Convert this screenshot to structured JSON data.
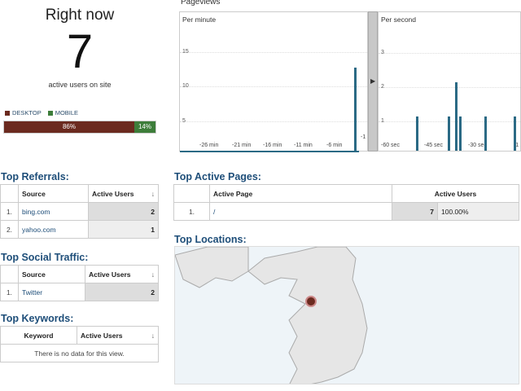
{
  "right_now": {
    "title": "Right now",
    "count": "7",
    "subtitle": "active users on site",
    "legend": [
      {
        "label": "DESKTOP",
        "color": "#6b2a1f"
      },
      {
        "label": "MOBILE",
        "color": "#3d7d3a"
      }
    ],
    "desktop_pct_label": "86%",
    "mobile_pct_label": "14%",
    "desktop_share": 86,
    "mobile_share": 14
  },
  "pageviews": {
    "title": "Pageviews",
    "per_minute": {
      "label": "Per minute",
      "y_ticks": [
        "15",
        "10",
        "5"
      ],
      "x_ticks": [
        "-26 min",
        "-21 min",
        "-16 min",
        "-11 min",
        "-6 min",
        "-1"
      ],
      "bars": [
        {
          "x": "-1",
          "value": 12
        }
      ]
    },
    "per_second": {
      "label": "Per second",
      "y_ticks": [
        "3",
        "2",
        "1"
      ],
      "x_ticks": [
        "-60 sec",
        "-45 sec",
        "-30 sec",
        "-1"
      ],
      "bars": [
        {
          "x": -45,
          "value": 1
        },
        {
          "x": -31,
          "value": 1
        },
        {
          "x": -28,
          "value": 2
        },
        {
          "x": -26,
          "value": 1
        },
        {
          "x": -15,
          "value": 1
        },
        {
          "x": -2,
          "value": 1
        }
      ]
    },
    "divider_icon": "chevron-right-icon"
  },
  "top_referrals": {
    "title": "Top Referrals:",
    "columns": [
      "Source",
      "Active Users"
    ],
    "rows": [
      {
        "n": "1.",
        "source": "bing.com",
        "users": "2"
      },
      {
        "n": "2.",
        "source": "yahoo.com",
        "users": "1"
      }
    ]
  },
  "top_social": {
    "title": "Top Social Traffic:",
    "columns": [
      "Source",
      "Active Users"
    ],
    "rows": [
      {
        "n": "1.",
        "source": "Twitter",
        "users": "2"
      }
    ]
  },
  "top_keywords": {
    "title": "Top Keywords:",
    "columns": [
      "Keyword",
      "Active Users"
    ],
    "empty": "There is no data for this view."
  },
  "top_pages": {
    "title": "Top Active Pages:",
    "columns": [
      "Active Page",
      "Active Users"
    ],
    "rows": [
      {
        "n": "1.",
        "page": "/",
        "users": "7",
        "pct": "100.00%"
      }
    ]
  },
  "top_locations": {
    "title": "Top Locations:"
  }
}
